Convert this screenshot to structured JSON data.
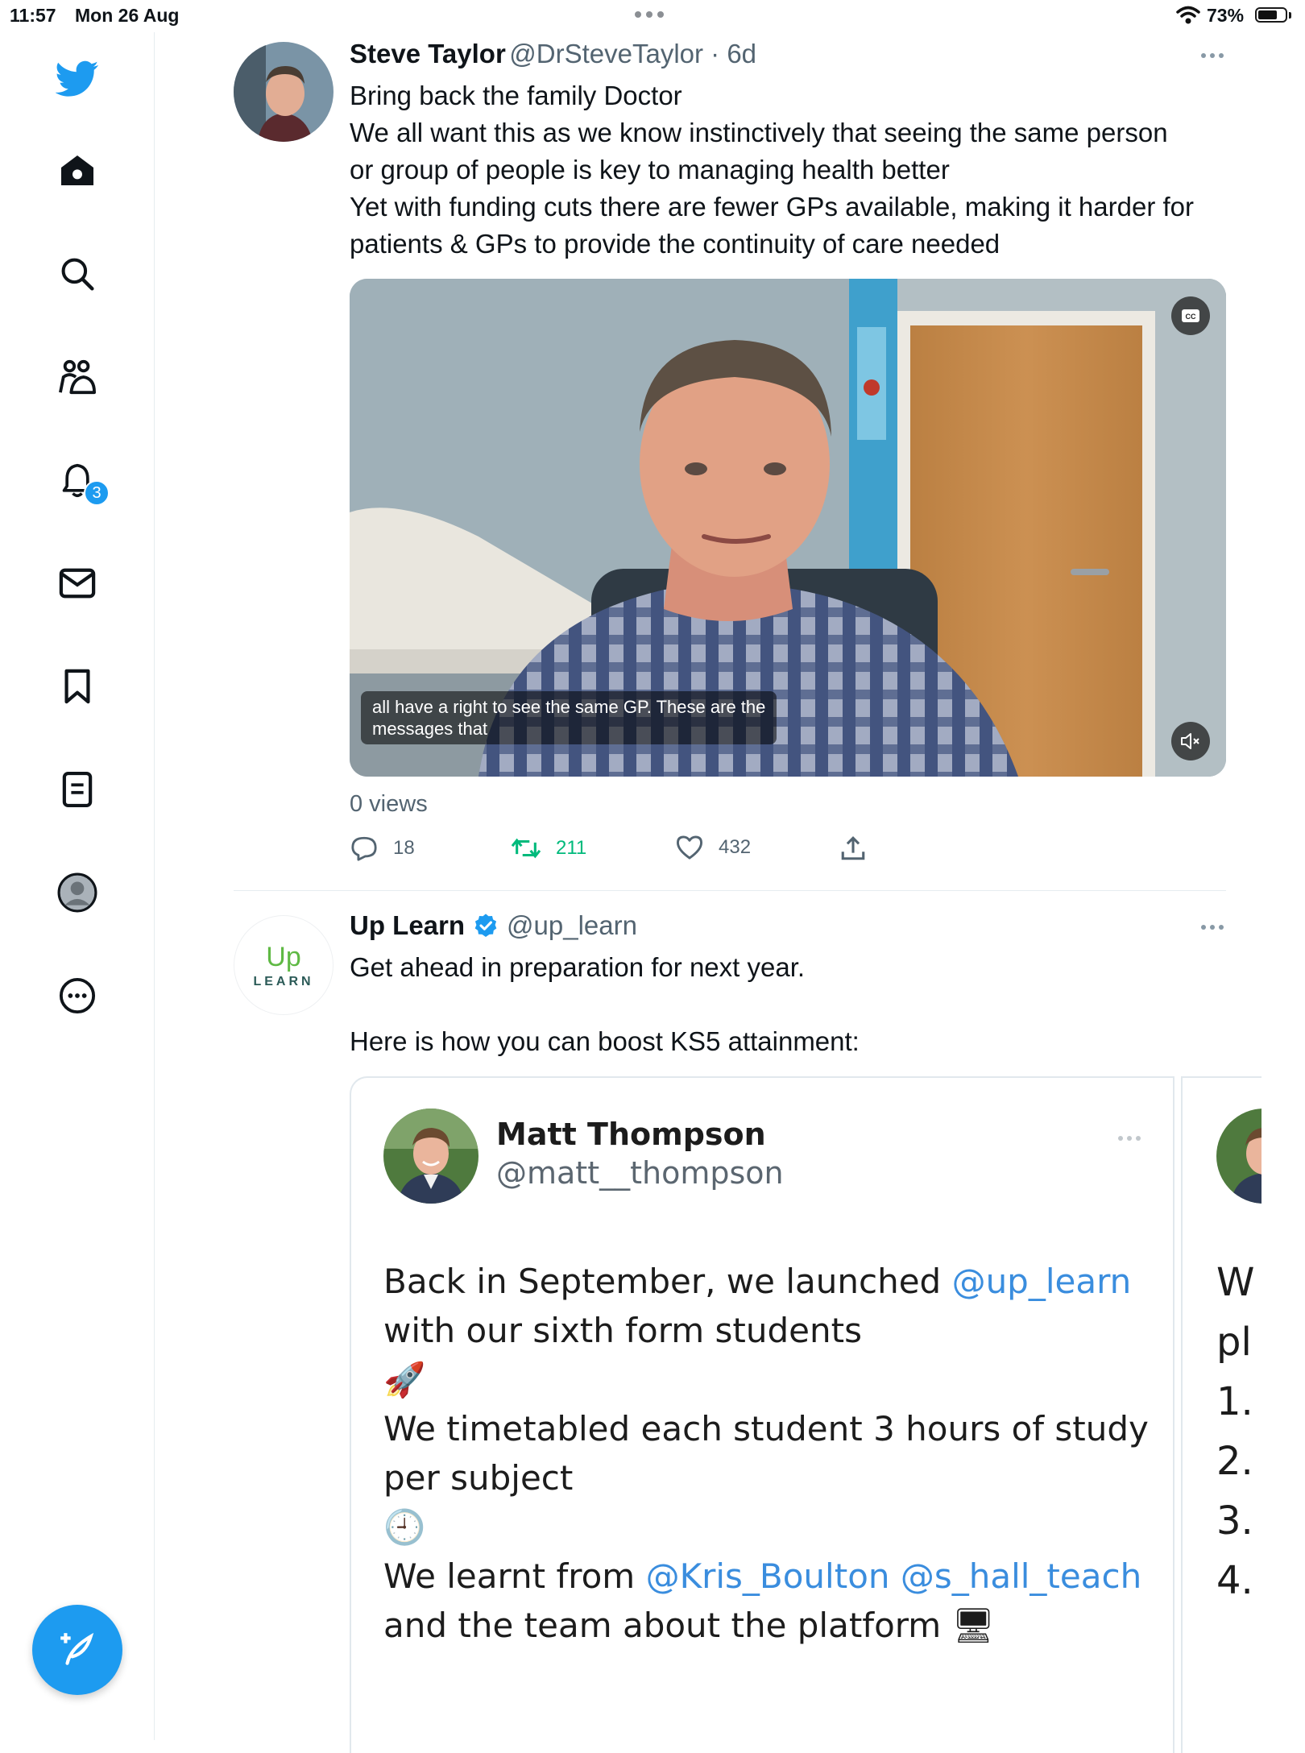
{
  "status_bar": {
    "time": "11:57",
    "date": "Mon 26 Aug",
    "battery": "73%",
    "battery_level": 0.73
  },
  "sidebar": {
    "notifications_badge": "3",
    "accent": "#1d9bf0"
  },
  "tweet1": {
    "name": "Steve Taylor",
    "handle": "@DrSteveTaylor · 6d",
    "lines": [
      "Bring back the family Doctor",
      "We all want this as we know instinctively that seeing the same person",
      "or group of people is key to managing health better",
      "Yet with funding cuts there are fewer GPs available, making it harder for",
      "patients & GPs to provide the continuity of care needed"
    ],
    "caption_line1": "all have a right to see the same GP. These are the",
    "caption_line2": "messages that",
    "cc_label": "CC",
    "views": "0 views",
    "replies": "18",
    "retweets": "211",
    "likes": "432"
  },
  "tweet2": {
    "name": "Up Learn",
    "handle": "@up_learn",
    "logo_top": "Up",
    "logo_bottom": "LEARN",
    "line1": "Get ahead in preparation for next year.",
    "line2": "Here is how you can boost KS5 attainment:",
    "card": {
      "author": "Matt Thompson",
      "author_handle": "@matt__thompson",
      "l1a": "Back in September, we launched ",
      "l1b": "@up_learn",
      "l2": "with our sixth form students",
      "l3": "🚀",
      "l4": "We timetabled each student 3 hours of study",
      "l5": "per subject",
      "l6": "🕘",
      "l7a": "We learnt from ",
      "l7b": "@Kris_Boulton @s_hall_teach",
      "l8": "and the team about the platform 🖥"
    },
    "card2_peek": [
      "W",
      "pl",
      "1.",
      "2.",
      "3.",
      "4."
    ]
  }
}
